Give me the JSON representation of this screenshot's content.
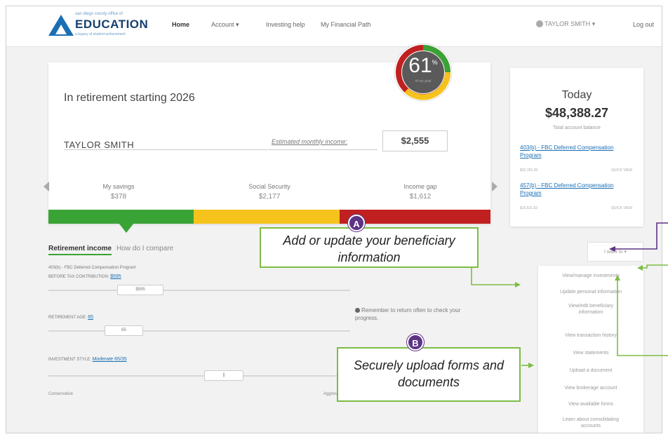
{
  "header": {
    "logo": {
      "top_line": "san diego county office of",
      "name": "EDUCATION",
      "tagline": "a legacy of student achievement"
    },
    "nav": [
      "Home",
      "Account",
      "Investing help",
      "My Financial Path"
    ],
    "user_name": "TAYLOR SMITH",
    "logout": "Log out"
  },
  "summary": {
    "title": "In retirement starting 2026",
    "score": "61",
    "score_suffix": "%",
    "score_sub": "of my goal",
    "name": "TAYLOR SMITH",
    "income_label": "Estimated monthly income:",
    "income_value": "$2,555",
    "stats": [
      {
        "label": "My savings",
        "value": "$378"
      },
      {
        "label": "Social Security",
        "value": "$2,177"
      },
      {
        "label": "Income gap",
        "value": "$1,612"
      }
    ],
    "colors": {
      "green": "#3aa336",
      "yellow": "#f5c31c",
      "red": "#c0201f"
    }
  },
  "tabs": [
    "Retirement income",
    "How do I compare"
  ],
  "sliders": {
    "plan_name": "403(b) - FBC Deferred Compensation Program",
    "contribution_label": "BEFORE TAX CONTRIBUTION:",
    "contribution_value": "$595",
    "age_label": "RETIREMENT AGE:",
    "age_value": "65",
    "style_label": "INVESTMENT STYLE:",
    "style_value": "Moderate 65/35",
    "conservative": "Conservative",
    "aggressive": "Aggressive"
  },
  "reminder": "Remember to return often to check your progress.",
  "today": {
    "title": "Today",
    "balance": "$48,388.27",
    "balance_label": "Total account balance",
    "accounts": [
      {
        "name": "403(b) - FBC Deferred Compensation Program",
        "balance": "$32,766.28",
        "link": "QUICK VIEW"
      },
      {
        "name": "457(b) - FBC Deferred Compensation Program",
        "balance": "$15,621.62",
        "link": "QUICK VIEW"
      }
    ]
  },
  "menu": {
    "toggle": "I want to",
    "items": [
      "View/manage investments",
      "Update personal information",
      "View/edit beneficiary information",
      "View transaction history",
      "View statements",
      "Upload a document",
      "View brokerage account",
      "View available forms",
      "Learn about consolidating accounts"
    ]
  },
  "callouts": {
    "a": {
      "badge": "A",
      "text": "Add or update your beneficiary information"
    },
    "b": {
      "badge": "B",
      "text": "Securely upload forms and documents"
    }
  }
}
